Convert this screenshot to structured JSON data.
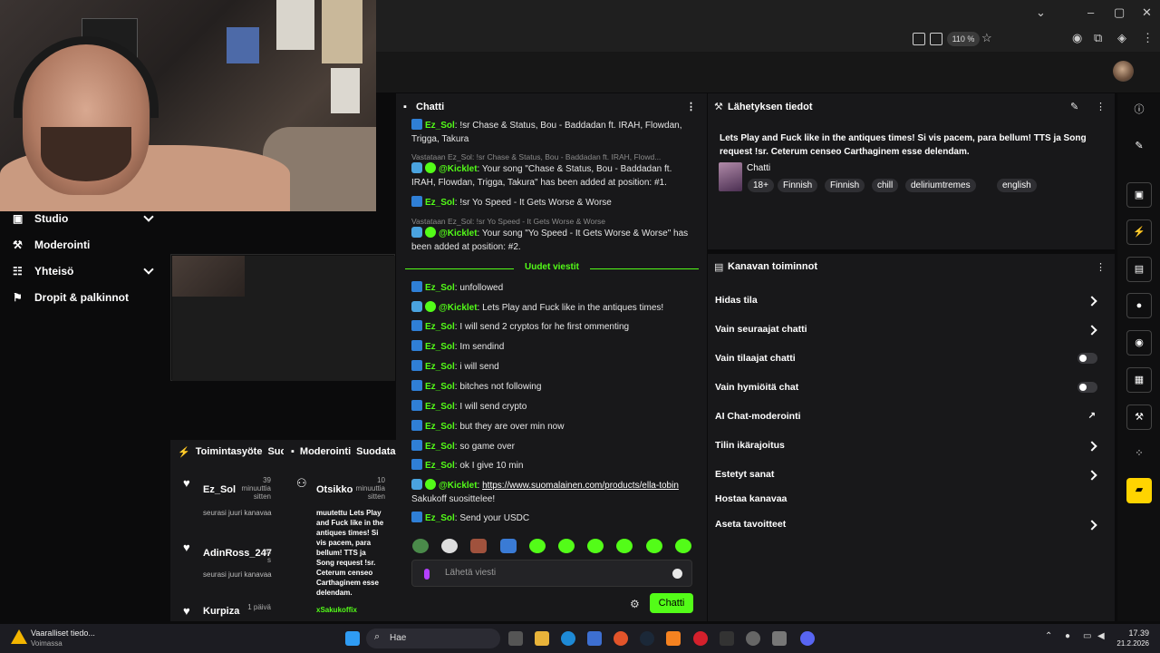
{
  "browser": {
    "zoom": "110 %"
  },
  "nav": {
    "items": [
      {
        "label": "Studio"
      },
      {
        "label": "Moderointi"
      },
      {
        "label": "Yhteisö"
      },
      {
        "label": "Dropit & palkinnot"
      }
    ]
  },
  "activity": {
    "title": "Toimintasyöte",
    "filter": "Suodata",
    "items": [
      {
        "name": "Ez_Sol",
        "time": "39 minuuttia sitten",
        "desc": "seurasi juuri kanavaa"
      },
      {
        "name": "AdinRoss_247",
        "time": "tu s",
        "desc": "seurasi juuri kanavaa"
      },
      {
        "name": "Kurpiza",
        "time": "1 päivä",
        "desc": ""
      }
    ]
  },
  "moderation": {
    "title": "Moderointi",
    "filter": "Suodata",
    "item": {
      "name": "Otsikko",
      "time": "10 minuuttia sitten",
      "desc": "muutettu Lets Play and Fuck like in the antiques times! Si vis pacem, para bellum! TTS ja Song request !sr. Ceterum censeo Carthaginem esse delendam.",
      "user": "xSakukoffix"
    }
  },
  "chat": {
    "title": "Chatti",
    "messages": [
      {
        "user": "Ez_Sol",
        "text": ": !sr Chase & Status, Bou - Baddadan ft. IRAH, Flowdan, Trigga, Takura"
      },
      {
        "reply": "Vastataan Ez_Sol: !sr Chase & Status, Bou - Baddadan ft. IRAH, Flowd..."
      },
      {
        "user": "@Kicklet",
        "text": ": Your song \"Chase & Status, Bou - Baddadan ft. IRAH, Flowdan, Trigga, Takura\" has been added at position: #1."
      },
      {
        "user": "Ez_Sol",
        "text": ": !sr Yo Speed - It Gets Worse & Worse"
      },
      {
        "reply": "Vastataan Ez_Sol: !sr Yo Speed - It Gets Worse & Worse"
      },
      {
        "user": "@Kicklet",
        "text": ": Your song \"Yo Speed - It Gets Worse & Worse\" has been added at position: #2."
      },
      {
        "user": "Ez_Sol",
        "text": ": unfollowed"
      },
      {
        "user": "@Kicklet",
        "text": ": Lets Play and Fuck like in the antiques times!"
      },
      {
        "user": "Ez_Sol",
        "text": ": I will send 2 cryptos for he first ommenting"
      },
      {
        "user": "Ez_Sol",
        "text": ": Im sendind"
      },
      {
        "user": "Ez_Sol",
        "text": ": i will send"
      },
      {
        "user": "Ez_Sol",
        "text": ": bitches not following"
      },
      {
        "user": "Ez_Sol",
        "text": ": I will send crypto"
      },
      {
        "user": "Ez_Sol",
        "text": ": but they are over min now"
      },
      {
        "user": "Ez_Sol",
        "text": ": so game over"
      },
      {
        "user": "Ez_Sol",
        "text": ": ok I give 10 min"
      },
      {
        "user": "@Kicklet",
        "text": ": ",
        "link": "https://www.suomalainen.com/products/ella-tobin",
        "tail": " Sakukoff suosittelee!"
      },
      {
        "user": "Ez_Sol",
        "text": ": Send your USDC"
      }
    ],
    "new_messages": "Uudet viestit",
    "input_placeholder": "Lähetä viesti",
    "send_label": "Chatti"
  },
  "info": {
    "title": "Lähetyksen tiedot",
    "stream_title": "Lets Play and Fuck like in the antiques times! Si vis pacem, para bellum! TTS ja Song request !sr. Ceterum censeo Carthaginem esse delendam.",
    "category": "Chatti",
    "tags": [
      "18+",
      "Finnish",
      "Finnish",
      "chill",
      "deliriumtremes",
      "english"
    ]
  },
  "actions": {
    "title": "Kanavan toiminnot",
    "rows": [
      {
        "label": "Hidas tila",
        "control": "arrow"
      },
      {
        "label": "Vain seuraajat chatti",
        "control": "arrow"
      },
      {
        "label": "Vain tilaajat chatti",
        "control": "toggle"
      },
      {
        "label": "Vain hymiöitä chat",
        "control": "toggle"
      },
      {
        "label": "AI Chat-moderointi",
        "control": "external"
      },
      {
        "label": "Tilin ikärajoitus",
        "control": "arrow"
      },
      {
        "label": "Estetyt sanat",
        "control": "arrow"
      },
      {
        "label": "Hostaa kanavaa",
        "control": "none"
      },
      {
        "label": "Aseta tavoitteet",
        "control": "arrow"
      }
    ]
  },
  "taskbar": {
    "alert_title": "Vaaralliset tiedo...",
    "alert_sub": "Voimassa",
    "search": "Hae",
    "time": "17.39",
    "date": "21.2.2026"
  }
}
